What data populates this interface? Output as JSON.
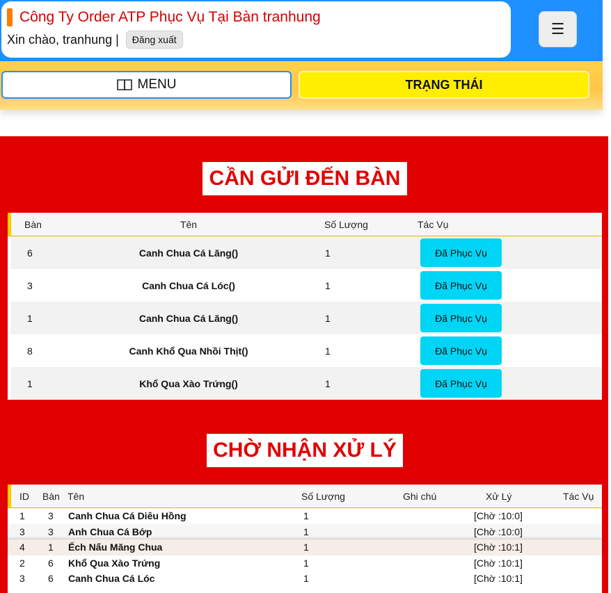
{
  "header": {
    "title": "Công Ty Order ATP Phục Vụ Tại Bàn tranhung",
    "greeting": "Xin chào, tranhung |",
    "logout_label": "Đăng xuất",
    "menu_icon": "☰"
  },
  "nav": {
    "menu_label": "MENU",
    "status_label": "TRẠNG THÁI"
  },
  "section1": {
    "title": "CẦN GỬI ĐẾN BÀN",
    "columns": [
      "Bàn",
      "Tên",
      "Số Lượng",
      "Tác Vụ"
    ],
    "rows": [
      {
        "ban": "6",
        "ten": "Canh Chua Cá Lăng()",
        "so_luong": "1",
        "action": "Đã Phục Vụ"
      },
      {
        "ban": "3",
        "ten": "Canh Chua Cá Lóc()",
        "so_luong": "1",
        "action": "Đã Phục Vụ"
      },
      {
        "ban": "1",
        "ten": "Canh Chua Cá Lăng()",
        "so_luong": "1",
        "action": "Đã Phục Vụ"
      },
      {
        "ban": "8",
        "ten": "Canh Khổ Qua Nhồi Thịt()",
        "so_luong": "1",
        "action": "Đã Phục Vụ"
      },
      {
        "ban": "1",
        "ten": "Khổ Qua Xào Trứng()",
        "so_luong": "1",
        "action": "Đã Phục Vụ"
      }
    ]
  },
  "section2": {
    "title": "CHỜ NHẬN XỬ LÝ",
    "columns": [
      "ID",
      "Bàn",
      "Tên",
      "Số Lượng",
      "Ghi chú",
      "Xử Lý",
      "Tác Vụ"
    ],
    "rows": [
      {
        "id": "1",
        "ban": "3",
        "ten": "Canh Chua Cá Diêu Hồng",
        "so_luong": "1",
        "ghi_chu": "",
        "xu_ly": "[Chờ :10:0]"
      },
      {
        "id": "3",
        "ban": "3",
        "ten": "Anh Chua Cá Bớp",
        "so_luong": "1",
        "ghi_chu": "",
        "xu_ly": "[Chờ :10:0]"
      },
      {
        "id": "4",
        "ban": "1",
        "ten": "Ếch Nấu Măng Chua",
        "so_luong": "1",
        "ghi_chu": "",
        "xu_ly": "[Chờ :10:1]"
      },
      {
        "id": "2",
        "ban": "6",
        "ten": "Khổ Qua Xào Trứng",
        "so_luong": "1",
        "ghi_chu": "",
        "xu_ly": "[Chờ :10:1]"
      },
      {
        "id": "3",
        "ban": "6",
        "ten": "Canh Chua Cá Lóc",
        "so_luong": "1",
        "ghi_chu": "",
        "xu_ly": "[Chờ :10:1]"
      }
    ]
  },
  "colors": {
    "brand_blue": "#1e90ff",
    "title_red": "#d40000",
    "content_red": "#e10000",
    "status_yellow": "#ffee00",
    "action_cyan": "#00d5f5"
  }
}
